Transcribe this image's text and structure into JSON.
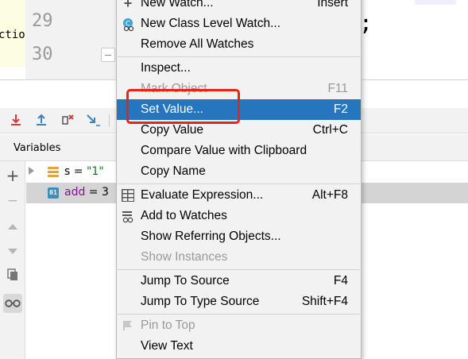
{
  "editor": {
    "left_snippet": "ctionT",
    "line_numbers": [
      "29",
      "30"
    ],
    "semicolon": ";"
  },
  "debug_toolbar": {
    "icons": [
      "download-red-icon",
      "upload-blue-icon",
      "delete-red-icon",
      "step-blue-icon"
    ]
  },
  "variables_panel": {
    "title": "Variables",
    "rows": [
      {
        "name": "s",
        "eq": " = ",
        "value": "\"1\"",
        "icon": "string-field-icon",
        "expandable": true
      },
      {
        "name": "add",
        "eq": " = ",
        "value": "3",
        "icon": "int-field-icon",
        "expandable": false
      }
    ],
    "side_buttons": [
      "plus-icon",
      "minus-icon",
      "up-icon",
      "down-icon",
      "copy-icon",
      "glasses-icon"
    ]
  },
  "context_menu": {
    "items": [
      {
        "label": "New Watch...",
        "shortcut": "Insert",
        "icon": "plus",
        "state": "normal"
      },
      {
        "label": "New Class Level Watch...",
        "shortcut": "",
        "icon": "class-watch",
        "state": "normal"
      },
      {
        "label": "Remove All Watches",
        "shortcut": "",
        "icon": "",
        "state": "normal"
      },
      {
        "label": "Inspect...",
        "shortcut": "",
        "icon": "",
        "state": "normal"
      },
      {
        "label": "Mark Object",
        "shortcut": "F11",
        "icon": "",
        "state": "disabled"
      },
      {
        "label": "Set Value...",
        "shortcut": "F2",
        "icon": "",
        "state": "selected"
      },
      {
        "label": "Copy Value",
        "shortcut": "Ctrl+C",
        "icon": "",
        "state": "normal"
      },
      {
        "label": "Compare Value with Clipboard",
        "shortcut": "",
        "icon": "",
        "state": "normal"
      },
      {
        "label": "Copy Name",
        "shortcut": "",
        "icon": "",
        "state": "normal"
      },
      {
        "label": "Evaluate Expression...",
        "shortcut": "Alt+F8",
        "icon": "grid",
        "state": "normal"
      },
      {
        "label": "Add to Watches",
        "shortcut": "",
        "icon": "watches",
        "state": "normal"
      },
      {
        "label": "Show Referring Objects...",
        "shortcut": "",
        "icon": "",
        "state": "normal"
      },
      {
        "label": "Show Instances",
        "shortcut": "",
        "icon": "",
        "state": "disabled"
      },
      {
        "label": "Jump To Source",
        "shortcut": "F4",
        "icon": "",
        "state": "normal"
      },
      {
        "label": "Jump To Type Source",
        "shortcut": "Shift+F4",
        "icon": "",
        "state": "normal"
      },
      {
        "label": "Pin to Top",
        "shortcut": "",
        "icon": "pin",
        "state": "disabled"
      },
      {
        "label": "View Text",
        "shortcut": "",
        "icon": "",
        "state": "normal"
      }
    ]
  },
  "colors": {
    "selection": "#2675bf",
    "annotation_box": "#e8231c",
    "string_value": "#067d17",
    "field_name": "#871094"
  }
}
